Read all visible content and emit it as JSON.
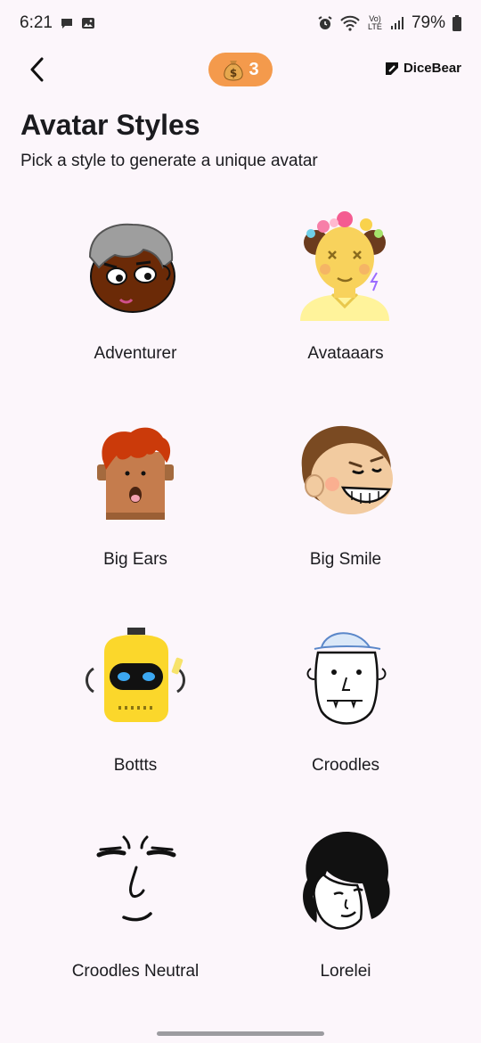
{
  "status_bar": {
    "time": "6:21",
    "network_label": "Vo) LTE",
    "battery_percent": "79%",
    "icons": [
      "chat-bubble-icon",
      "gallery-icon",
      "alarm-icon",
      "wifi-icon",
      "signal-icon",
      "battery-icon"
    ]
  },
  "app_bar": {
    "back_icon": "chevron-left-icon",
    "coin_icon": "money-bag-icon",
    "coin_count": "3",
    "brand": "DiceBear"
  },
  "header": {
    "title": "Avatar Styles",
    "subtitle": "Pick a style to generate a unique avatar"
  },
  "styles": [
    {
      "label": "Adventurer"
    },
    {
      "label": "Avataaars"
    },
    {
      "label": "Big Ears"
    },
    {
      "label": "Big Smile"
    },
    {
      "label": "Bottts"
    },
    {
      "label": "Croodles"
    },
    {
      "label": "Croodles Neutral"
    },
    {
      "label": "Lorelei"
    }
  ],
  "colors": {
    "background": "#FCF6FB",
    "coin_badge": "#F49A4C",
    "text": "#1B1B1F"
  }
}
